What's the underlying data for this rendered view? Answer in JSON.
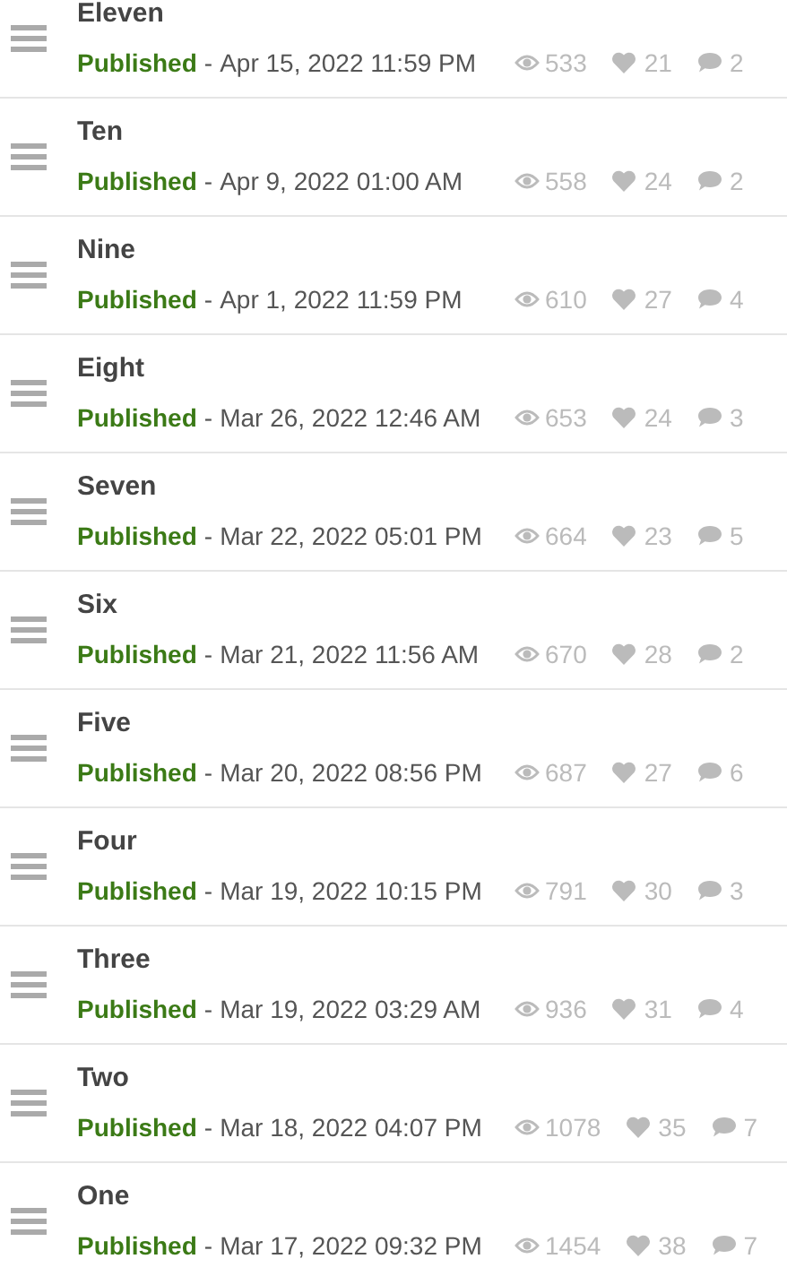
{
  "posts": [
    {
      "title": "Eleven",
      "status": "Published",
      "separator": "-",
      "date": "Apr 15, 2022 11:59 PM",
      "views": "533",
      "likes": "21",
      "comments": "2"
    },
    {
      "title": "Ten",
      "status": "Published",
      "separator": "-",
      "date": "Apr 9, 2022 01:00 AM",
      "views": "558",
      "likes": "24",
      "comments": "2"
    },
    {
      "title": "Nine",
      "status": "Published",
      "separator": "-",
      "date": "Apr 1, 2022 11:59 PM",
      "views": "610",
      "likes": "27",
      "comments": "4"
    },
    {
      "title": "Eight",
      "status": "Published",
      "separator": "-",
      "date": "Mar 26, 2022 12:46 AM",
      "views": "653",
      "likes": "24",
      "comments": "3"
    },
    {
      "title": "Seven",
      "status": "Published",
      "separator": "-",
      "date": "Mar 22, 2022 05:01 PM",
      "views": "664",
      "likes": "23",
      "comments": "5"
    },
    {
      "title": "Six",
      "status": "Published",
      "separator": "-",
      "date": "Mar 21, 2022 11:56 AM",
      "views": "670",
      "likes": "28",
      "comments": "2"
    },
    {
      "title": "Five",
      "status": "Published",
      "separator": "-",
      "date": "Mar 20, 2022 08:56 PM",
      "views": "687",
      "likes": "27",
      "comments": "6"
    },
    {
      "title": "Four",
      "status": "Published",
      "separator": "-",
      "date": "Mar 19, 2022 10:15 PM",
      "views": "791",
      "likes": "30",
      "comments": "3"
    },
    {
      "title": "Three",
      "status": "Published",
      "separator": "-",
      "date": "Mar 19, 2022 03:29 AM",
      "views": "936",
      "likes": "31",
      "comments": "4"
    },
    {
      "title": "Two",
      "status": "Published",
      "separator": "-",
      "date": "Mar 18, 2022 04:07 PM",
      "views": "1078",
      "likes": "35",
      "comments": "7"
    },
    {
      "title": "One",
      "status": "Published",
      "separator": "-",
      "date": "Mar 17, 2022 09:32 PM",
      "views": "1454",
      "likes": "38",
      "comments": "7"
    }
  ]
}
